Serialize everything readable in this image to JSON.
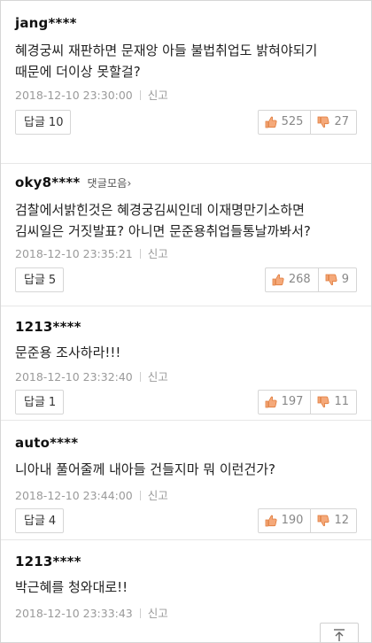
{
  "comments": [
    {
      "author": "jang****",
      "text_lines": [
        "혜경궁씨 재판하면 문재앙 아들 불법취업도 밝혀야되기",
        "때문에 더이상 못할걸?"
      ],
      "datetime": "2018-12-10 23:30:00",
      "report": "신고",
      "reply_label": "답글",
      "reply_count": "10",
      "likes": "525",
      "dislikes": "27"
    },
    {
      "author": "oky8****",
      "author_link": "댓글모음›",
      "text_lines": [
        "검찰에서밝힌것은 혜경궁김씨인데 이재명만기소하면",
        "김씨일은 거짓발표? 아니면 문준용취업들통날까봐서?"
      ],
      "datetime": "2018-12-10 23:35:21",
      "report": "신고",
      "reply_label": "답글",
      "reply_count": "5",
      "likes": "268",
      "dislikes": "9"
    },
    {
      "author": "1213****",
      "text_lines": [
        "문준용 조사하라!!!"
      ],
      "datetime": "2018-12-10 23:32:40",
      "report": "신고",
      "reply_label": "답글",
      "reply_count": "1",
      "likes": "197",
      "dislikes": "11"
    },
    {
      "author": "auto****",
      "text_lines": [
        "니아내 풀어줄께 내아들 건들지마 뭐 이런건가?"
      ],
      "datetime": "2018-12-10 23:44:00",
      "report": "신고",
      "reply_label": "답글",
      "reply_count": "4",
      "likes": "190",
      "dislikes": "12"
    },
    {
      "author": "1213****",
      "text_lines": [
        "박근혜를 청와대로!!"
      ],
      "datetime": "2018-12-10 23:33:43",
      "report": "신고"
    }
  ],
  "colors": {
    "like_icon": "#e07a3a",
    "dislike_icon": "#e07a3a",
    "meta_text": "#9a9a9a"
  },
  "icons": {
    "like": "thumbs-up-icon",
    "dislike": "thumbs-down-icon",
    "scroll_top": "arrow-up-icon"
  }
}
